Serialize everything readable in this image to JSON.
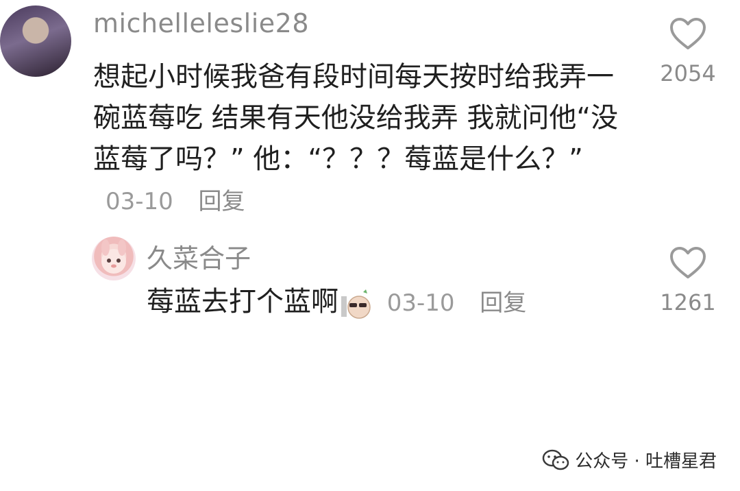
{
  "comments": [
    {
      "username": "michelleleslie28",
      "text": "想起小时候我爸有段时间每天按时给我弄一碗蓝莓吃 结果有天他没给我弄 我就问他“没蓝莓了吗？” 他：“？？？莓蓝是什么？”",
      "date": "03-10",
      "reply_label": "回复",
      "likes": "2054",
      "like_icon": "heart-outline-icon"
    },
    {
      "username": "久菜合子",
      "text": "莓蓝去打个蓝啊",
      "sticker": "sunglasses-potato-sticker-icon",
      "date": "03-10",
      "reply_label": "回复",
      "likes": "1261",
      "like_icon": "heart-outline-icon"
    }
  ],
  "watermark": {
    "label": "公众号 · 吐槽星君",
    "icon": "wechat-icon"
  },
  "colors": {
    "text_primary": "#1f1f1f",
    "text_secondary": "#8a8a8a",
    "background": "#ffffff"
  }
}
